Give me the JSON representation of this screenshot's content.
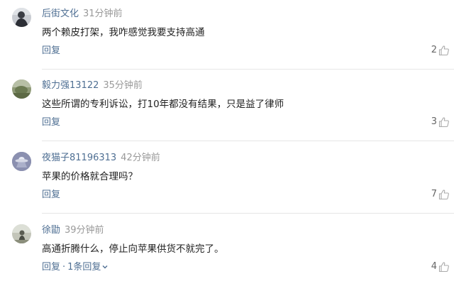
{
  "comments": [
    {
      "user": "后街文化",
      "time": "31分钟前",
      "text": "两个赖皮打架，我咋感觉我要支持高通",
      "reply_label": "回复",
      "likes": "2",
      "avatar_icon": "dark-figure-avatar"
    },
    {
      "user": "毅力强13122",
      "time": "35分钟前",
      "text": "这些所谓的专利诉讼，打10年都没有结果，只是益了律师",
      "reply_label": "回复",
      "likes": "3",
      "avatar_icon": "landscape-avatar"
    },
    {
      "user": "夜猫子81196313",
      "time": "42分钟前",
      "text": "苹果的价格就合理吗？",
      "reply_label": "回复",
      "likes": "7",
      "avatar_icon": "ufo-avatar"
    },
    {
      "user": "徐勖",
      "time": "39分钟前",
      "text": "高通折腾什么，停止向苹果供货不就完了。",
      "reply_label": "回复",
      "replies_label": "1条回复",
      "likes": "4",
      "avatar_icon": "outdoor-photo-avatar"
    }
  ],
  "colors": {
    "username": "#4f6f93",
    "time": "#999999",
    "text": "#222222",
    "like_count": "#666666",
    "like_icon": "#aaaaaa",
    "divider": "#e6e6e6"
  }
}
